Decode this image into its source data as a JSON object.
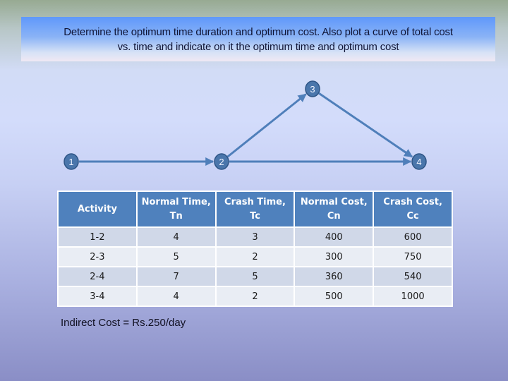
{
  "title": {
    "line1": "Determine the optimum time duration and optimum cost. Also plot a curve of total cost",
    "line2": "vs. time and indicate on it the optimum time and optimum cost"
  },
  "network": {
    "nodes": [
      {
        "id": "1",
        "label": "1"
      },
      {
        "id": "2",
        "label": "2"
      },
      {
        "id": "3",
        "label": "3"
      },
      {
        "id": "4",
        "label": "4"
      }
    ],
    "edges": [
      {
        "from": "1",
        "to": "2"
      },
      {
        "from": "2",
        "to": "3"
      },
      {
        "from": "3",
        "to": "4"
      },
      {
        "from": "2",
        "to": "4"
      }
    ],
    "node_color": "#4a76ab",
    "edge_color": "#4f7fba"
  },
  "table": {
    "headers": [
      "Activity",
      "Normal Time, Tn",
      "Crash Time, Tc",
      "Normal Cost, Cn",
      "Crash Cost, Cc"
    ],
    "rows": [
      [
        "1-2",
        "4",
        "3",
        "400",
        "600"
      ],
      [
        "2-3",
        "5",
        "2",
        "300",
        "750"
      ],
      [
        "2-4",
        "7",
        "5",
        "360",
        "540"
      ],
      [
        "3-4",
        "4",
        "2",
        "500",
        "1000"
      ]
    ],
    "header_color": "#4f81bd"
  },
  "note": "Indirect Cost = Rs.250/day"
}
